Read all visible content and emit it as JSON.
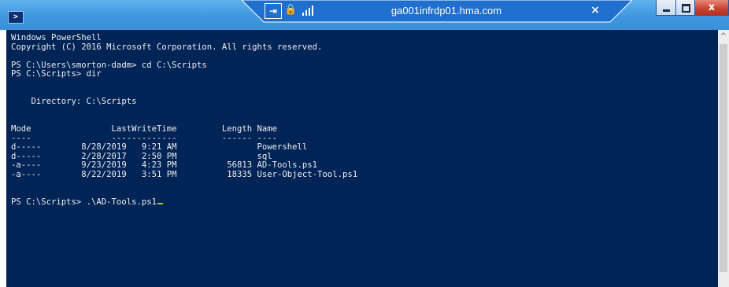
{
  "window": {
    "icon": "powershell-icon"
  },
  "rdp_bar": {
    "pin_label": "⇥",
    "host": "ga001infrdp01.hma.com",
    "close_label": "×"
  },
  "window_controls": {
    "close_label": "x"
  },
  "console": {
    "lines": [
      "Windows PowerShell",
      "Copyright (C) 2016 Microsoft Corporation. All rights reserved.",
      "",
      "PS C:\\Users\\smorton-dadm> cd C:\\Scripts",
      "PS C:\\Scripts> dir",
      "",
      "",
      "    Directory: C:\\Scripts",
      "",
      "",
      "Mode                LastWriteTime         Length Name",
      "----                -------------         ------ ----",
      "d-----        8/28/2019   9:21 AM                Powershell",
      "d-----        2/28/2017   2:50 PM                sql",
      "-a----        9/23/2019   4:23 PM          56813 AD-Tools.ps1",
      "-a----        8/22/2019   3:51 PM          18335 User-Object-Tool.ps1",
      "",
      "",
      "PS C:\\Scripts> .\\AD-Tools.ps1"
    ]
  },
  "scrollbar": {
    "up_arrow": "^"
  },
  "colors": {
    "titlebar": "#3f97e0",
    "console_bg": "#012456",
    "console_fg": "#eeedf0",
    "cursor": "#9acd32"
  }
}
